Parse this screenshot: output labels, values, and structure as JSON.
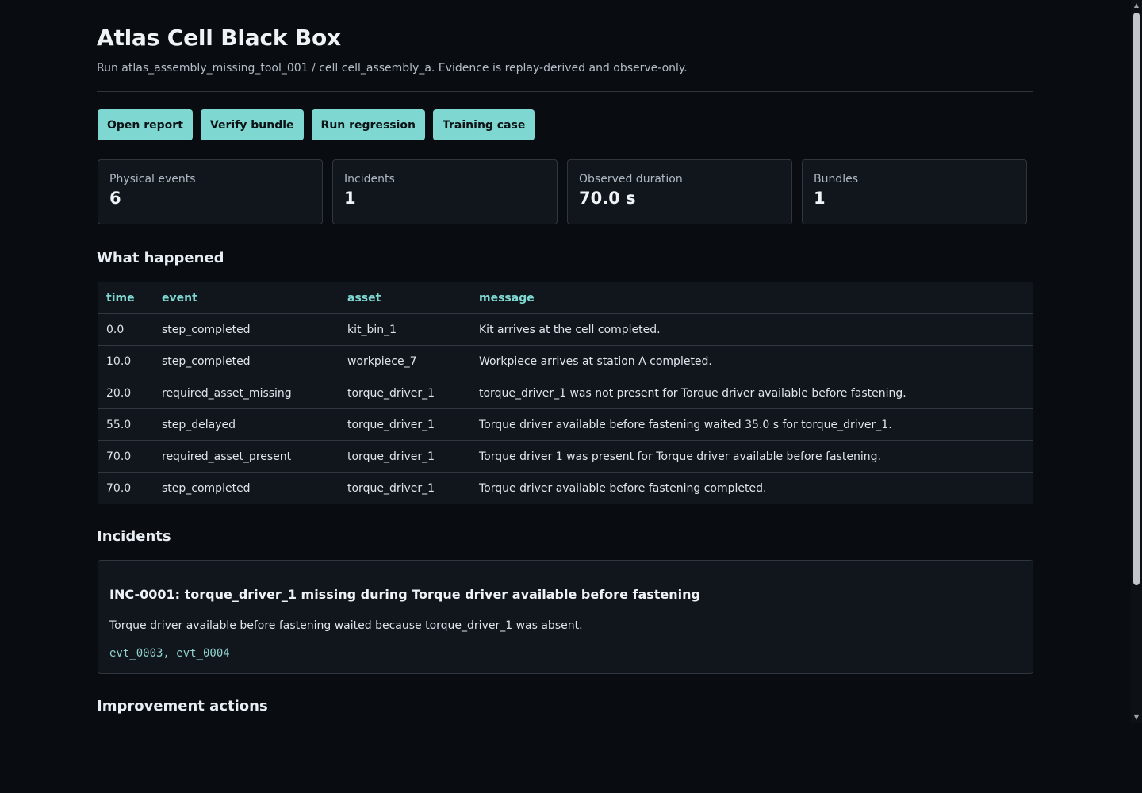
{
  "header": {
    "title": "Atlas Cell Black Box",
    "subtitle": "Run atlas_assembly_missing_tool_001 / cell cell_assembly_a. Evidence is replay-derived and observe-only."
  },
  "actions": [
    {
      "label": "Open report"
    },
    {
      "label": "Verify bundle"
    },
    {
      "label": "Run regression"
    },
    {
      "label": "Training case"
    }
  ],
  "stats": [
    {
      "label": "Physical events",
      "value": "6"
    },
    {
      "label": "Incidents",
      "value": "1"
    },
    {
      "label": "Observed duration",
      "value": "70.0 s"
    },
    {
      "label": "Bundles",
      "value": "1"
    }
  ],
  "timeline": {
    "heading": "What happened",
    "columns": [
      "time",
      "event",
      "asset",
      "message"
    ],
    "rows": [
      [
        "0.0",
        "step_completed",
        "kit_bin_1",
        "Kit arrives at the cell completed."
      ],
      [
        "10.0",
        "step_completed",
        "workpiece_7",
        "Workpiece arrives at station A completed."
      ],
      [
        "20.0",
        "required_asset_missing",
        "torque_driver_1",
        "torque_driver_1 was not present for Torque driver available before fastening."
      ],
      [
        "55.0",
        "step_delayed",
        "torque_driver_1",
        "Torque driver available before fastening waited 35.0 s for torque_driver_1."
      ],
      [
        "70.0",
        "required_asset_present",
        "torque_driver_1",
        "Torque driver 1 was present for Torque driver available before fastening."
      ],
      [
        "70.0",
        "step_completed",
        "torque_driver_1",
        "Torque driver available before fastening completed."
      ]
    ]
  },
  "incidents": {
    "heading": "Incidents",
    "items": [
      {
        "title": "INC-0001: torque_driver_1 missing during Torque driver available before fastening",
        "description": "Torque driver available before fastening waited because torque_driver_1 was absent.",
        "evidence": "evt_0003, evt_0004"
      }
    ]
  },
  "improvements": {
    "heading": "Improvement actions"
  },
  "scrollbar": {
    "up_icon": "triangle-up-icon",
    "down_icon": "triangle-down-icon"
  }
}
